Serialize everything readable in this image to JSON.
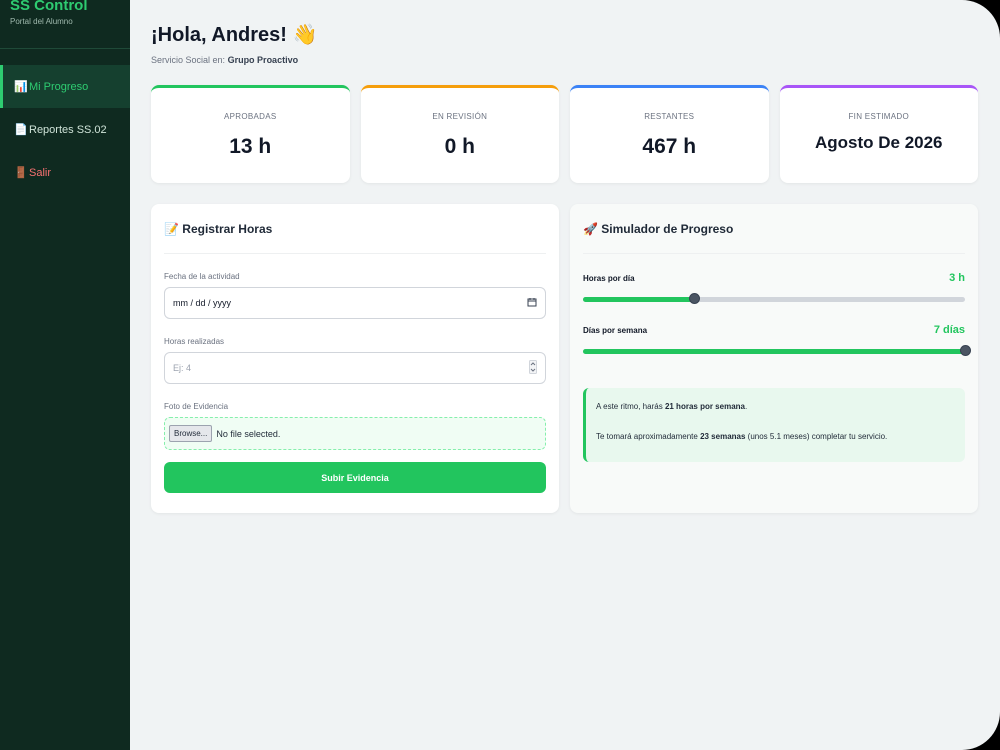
{
  "sidebar": {
    "brand_title": "SS Control",
    "brand_subtitle": "Portal del Alumno",
    "items": [
      {
        "icon": "📊",
        "label": "Mi Progreso"
      },
      {
        "icon": "📄",
        "label": "Reportes SS.02"
      },
      {
        "icon": "🚪",
        "label": "Salir"
      }
    ]
  },
  "header": {
    "greeting": "¡Hola, Andres! 👋",
    "service_prefix": "Servicio Social en:",
    "service_org": "Grupo Proactivo"
  },
  "stats": [
    {
      "label": "Aprobadas",
      "value": "13 h",
      "color": "#22c55e"
    },
    {
      "label": "En Revisión",
      "value": "0 h",
      "color": "#f59e0b"
    },
    {
      "label": "Restantes",
      "value": "467 h",
      "color": "#3b82f6"
    },
    {
      "label": "Fin Estimado",
      "value": "Agosto De 2026",
      "color": "#a855f7"
    }
  ],
  "register": {
    "title": "📝 Registrar Horas",
    "date_label": "Fecha de la actividad",
    "date_placeholder": "mm / dd / yyyy",
    "hours_label": "Horas realizadas",
    "hours_placeholder": "Ej: 4",
    "photo_label": "Foto de Evidencia",
    "browse_label": "Browse...",
    "file_status": "No file selected.",
    "submit_label": "Subir Evidencia"
  },
  "simulator": {
    "title": "🚀 Simulador de Progreso",
    "hours_label": "Horas por día",
    "hours_value_text": "3 h",
    "hours_fraction": 0.29,
    "days_label": "Días por semana",
    "days_value_text": "7 días",
    "days_fraction": 1.0,
    "result_line1_prefix": "A este ritmo, harás",
    "result_line1_bold": "21 horas por semana",
    "result_line1_suffix": ".",
    "result_line2_prefix": "Te tomará aproximadamente",
    "result_line2_bold": "23 semanas",
    "result_line2_suffix": "(unos 5.1 meses) completar tu servicio."
  }
}
